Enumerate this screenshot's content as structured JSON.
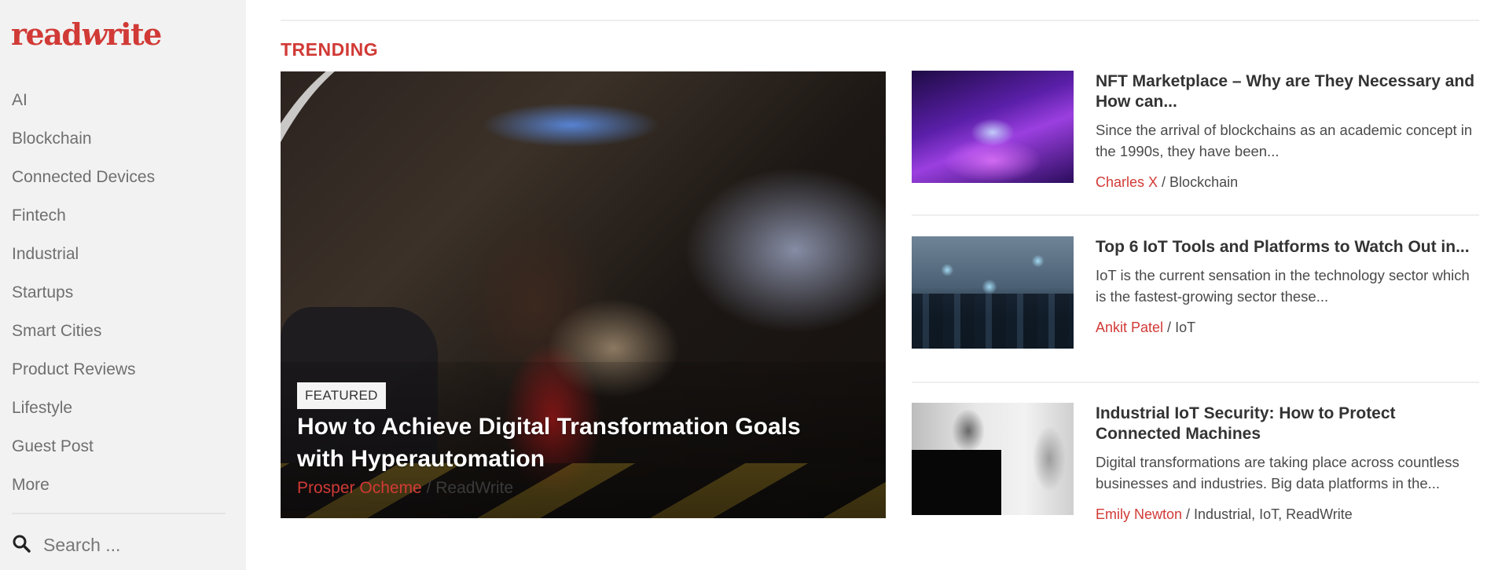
{
  "brand": {
    "logo_text_1": "read",
    "logo_text_w": "w",
    "logo_text_2": "rite",
    "accent_color": "#d13a36"
  },
  "sidebar": {
    "nav_items": [
      {
        "label": "AI"
      },
      {
        "label": "Blockchain"
      },
      {
        "label": "Connected Devices"
      },
      {
        "label": "Fintech"
      },
      {
        "label": "Industrial"
      },
      {
        "label": "Startups"
      },
      {
        "label": "Smart Cities"
      },
      {
        "label": "Product Reviews"
      },
      {
        "label": "Lifestyle"
      },
      {
        "label": "Guest Post"
      },
      {
        "label": "More"
      }
    ],
    "search": {
      "icon": "search-icon",
      "placeholder": "Search ...",
      "value": ""
    }
  },
  "main": {
    "section_title": "TRENDING",
    "featured": {
      "badge": "FEATURED",
      "title": "How to Achieve Digital Transformation Goals with Hyperautomation",
      "author": "Prosper Ocheme",
      "separator": " / ",
      "category": "ReadWrite"
    },
    "articles": [
      {
        "title": "NFT Marketplace – Why are They Necessary and How can...",
        "excerpt": "Since the arrival of blockchains as an academic concept in the 1990s, they have been...",
        "author": "Charles X",
        "separator": " / ",
        "category": "Blockchain"
      },
      {
        "title": "Top 6 IoT Tools and Platforms to Watch Out in...",
        "excerpt": "IoT is the current sensation in the technology sector which is the fastest-growing sector these...",
        "author": "Ankit Patel",
        "separator": " / ",
        "category": "IoT"
      },
      {
        "title": "Industrial IoT Security: How to Protect Connected Machines",
        "excerpt": "Digital transformations are taking place across countless businesses and industries. Big data platforms in the...",
        "author": "Emily Newton",
        "separator": " / ",
        "category": "Industrial, IoT, ReadWrite"
      }
    ]
  }
}
